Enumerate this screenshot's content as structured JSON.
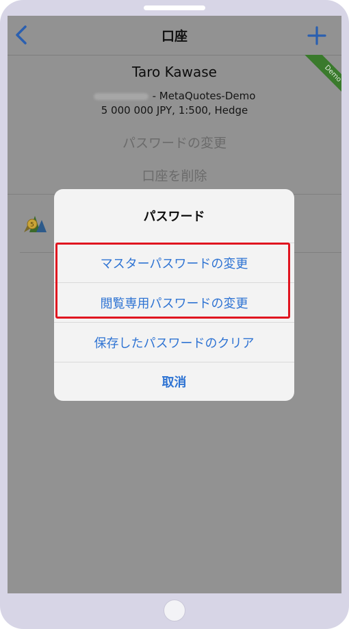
{
  "nav": {
    "title": "口座",
    "back_icon": "chevron-left-icon",
    "add_icon": "plus-icon"
  },
  "account": {
    "badge": "Demo",
    "name": "Taro Kawase",
    "server": "- MetaQuotes-Demo",
    "details": "5 000 000 JPY, 1:500, Hedge"
  },
  "menu": {
    "change_password": "パスワードの変更",
    "delete_account": "口座を削除"
  },
  "dialog": {
    "title": "パスワード",
    "options": [
      "マスターパスワードの変更",
      "閲覧専用パスワードの変更",
      "保存したパスワードのクリア"
    ],
    "cancel": "取消"
  },
  "colors": {
    "accent": "#2e73d3",
    "highlight": "#e0141f",
    "demo_badge": "#3a7a2c"
  }
}
